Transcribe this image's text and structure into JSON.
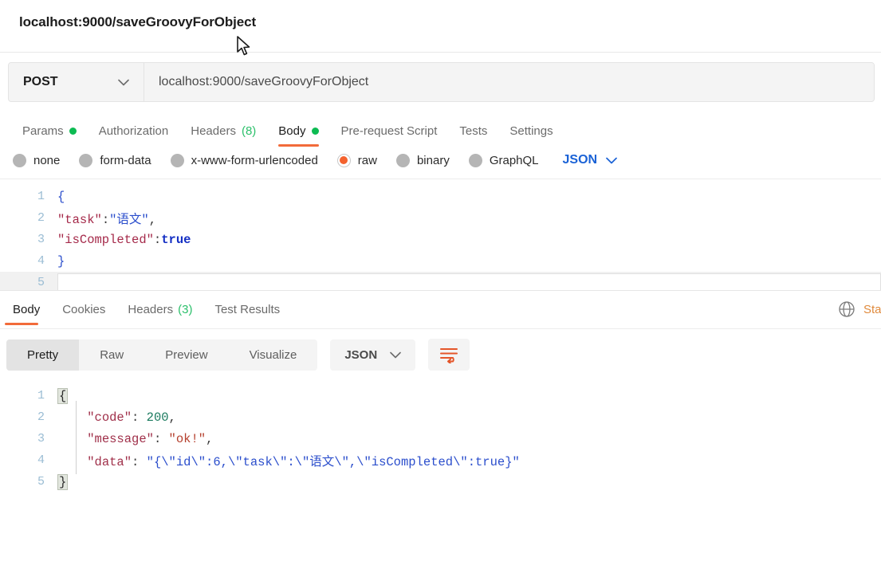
{
  "window": {
    "title": "localhost:9000/saveGroovyForObject"
  },
  "request": {
    "method": "POST",
    "url": "localhost:9000/saveGroovyForObject",
    "tabs": [
      {
        "label": "Params",
        "indicator": "dot-green",
        "active": false
      },
      {
        "label": "Authorization",
        "indicator": "",
        "active": false
      },
      {
        "label": "Headers",
        "count": "(8)",
        "active": false
      },
      {
        "label": "Body",
        "indicator": "dot-green",
        "active": true
      },
      {
        "label": "Pre-request Script",
        "indicator": "",
        "active": false
      },
      {
        "label": "Tests",
        "indicator": "",
        "active": false
      },
      {
        "label": "Settings",
        "indicator": "",
        "active": false
      }
    ],
    "body_types": [
      {
        "label": "none",
        "checked": false
      },
      {
        "label": "form-data",
        "checked": false
      },
      {
        "label": "x-www-form-urlencoded",
        "checked": false
      },
      {
        "label": "raw",
        "checked": true
      },
      {
        "label": "binary",
        "checked": false
      },
      {
        "label": "GraphQL",
        "checked": false
      }
    ],
    "format_label": "JSON",
    "body_lines": [
      {
        "no": "1",
        "text": "{"
      },
      {
        "no": "2",
        "text": "\"task\":\"语文\","
      },
      {
        "no": "3",
        "text": "\"isCompleted\":true"
      },
      {
        "no": "4",
        "text": "}"
      },
      {
        "no": "5",
        "text": ""
      }
    ]
  },
  "response": {
    "tabs": [
      {
        "label": "Body",
        "count": "",
        "active": true
      },
      {
        "label": "Cookies",
        "count": "",
        "active": false
      },
      {
        "label": "Headers",
        "count": "(3)",
        "active": false
      },
      {
        "label": "Test Results",
        "count": "",
        "active": false
      }
    ],
    "status_text": "Sta",
    "view_modes": [
      {
        "label": "Pretty",
        "active": true
      },
      {
        "label": "Raw",
        "active": false
      },
      {
        "label": "Preview",
        "active": false
      },
      {
        "label": "Visualize",
        "active": false
      }
    ],
    "format_label": "JSON",
    "body_lines": [
      {
        "no": "1",
        "text": "{"
      },
      {
        "no": "2",
        "key": "\"code\"",
        "value": "200",
        "kind": "number",
        "trail": ","
      },
      {
        "no": "3",
        "key": "\"message\"",
        "value": "\"ok!\"",
        "kind": "string",
        "trail": ","
      },
      {
        "no": "4",
        "key": "\"data\"",
        "value": "\"{\\\"id\\\":6,\\\"task\\\":\\\"语文\\\",\\\"isCompleted\\\":true}\"",
        "kind": "blue",
        "trail": ""
      },
      {
        "no": "5",
        "text": "}"
      }
    ]
  },
  "colors": {
    "accent": "#f26b3a",
    "green": "#0cbb52",
    "blue": "#1a62d6",
    "orange_radio": "#f4622e"
  }
}
